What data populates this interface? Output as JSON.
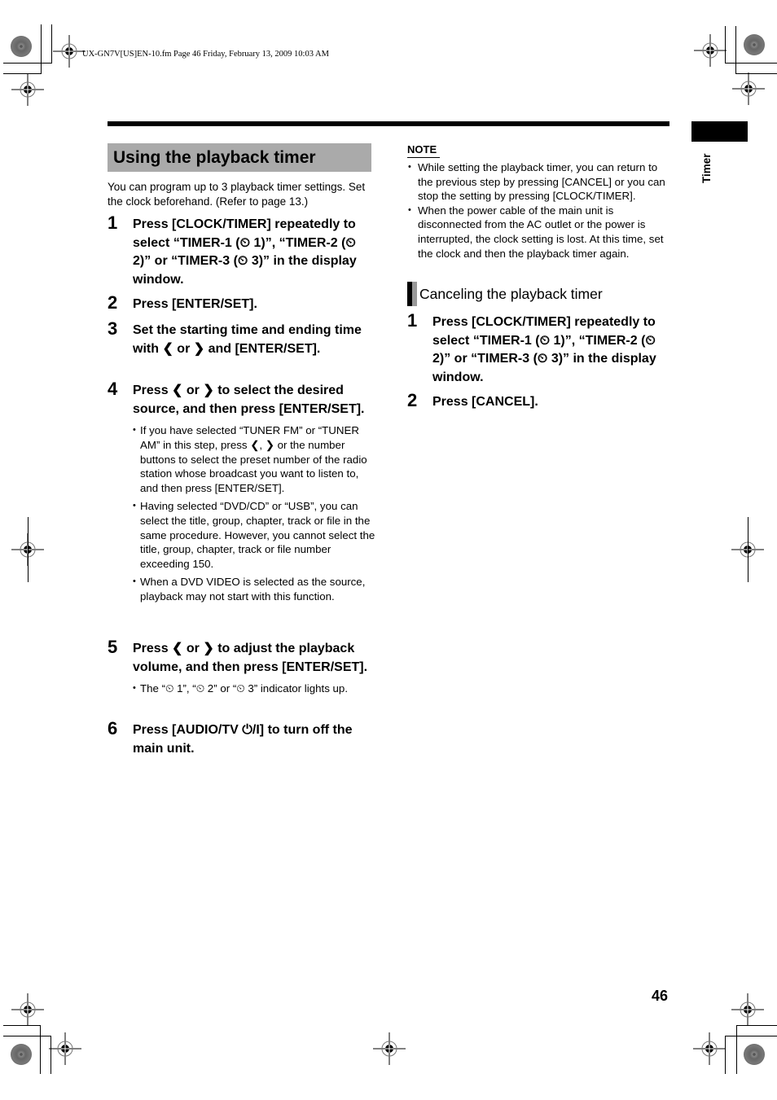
{
  "slug": "UX-GN7V[US]EN-10.fm  Page 46  Friday, February 13, 2009  10:03 AM",
  "side_tab": {
    "label": "Timer"
  },
  "section": {
    "title": "Using the playback timer",
    "intro": "You can program up to 3 playback timer settings. Set the clock beforehand. (Refer to page 13.)"
  },
  "steps": [
    {
      "num": "1",
      "text": "Press [CLOCK/TIMER] repeatedly to select “TIMER-1 (⏲ 1)”, “TIMER-2 (⏲ 2)” or “TIMER-3 (⏲ 3)” in the display window."
    },
    {
      "num": "2",
      "text": "Press [ENTER/SET]."
    },
    {
      "num": "3",
      "text": "Set the starting time and ending time with ❮ or ❯ and [ENTER/SET]."
    },
    {
      "num": "4",
      "text": "Press ❮ or ❯ to select the desired source, and then press [ENTER/SET].",
      "bullets": [
        "If you have selected “TUNER FM” or “TUNER AM” in this step, press ❮, ❯ or the number buttons to select the preset number of the radio station whose broadcast you want to listen to, and then press [ENTER/SET].",
        "Having selected “DVD/CD” or “USB”, you can select the title, group, chapter, track or file in the same procedure. However, you cannot select the title, group, chapter, track or file number exceeding 150.",
        "When a DVD VIDEO is selected as the source, playback may not start with this function."
      ]
    },
    {
      "num": "5",
      "text": "Press ❮ or ❯ to adjust the playback volume, and then press [ENTER/SET].",
      "bullets": [
        "The “⏲ 1”, “⏲ 2” or “⏲ 3” indicator lights up."
      ]
    },
    {
      "num": "6",
      "text": "Press [AUDIO/TV ⏻/I] to turn off the main unit."
    }
  ],
  "note": {
    "heading": "NOTE",
    "items": [
      "While setting the playback timer, you can return to the previous step by pressing [CANCEL] or you can stop the setting by pressing [CLOCK/TIMER].",
      "When the power cable of the main unit is disconnected from the AC outlet or the power is interrupted, the clock setting is lost. At this time, set the clock and then the playback timer again."
    ]
  },
  "cancel_section": {
    "title": "Canceling the playback timer",
    "steps": [
      {
        "num": "1",
        "text": "Press [CLOCK/TIMER] repeatedly to select “TIMER-1 (⏲ 1)”, “TIMER-2 (⏲ 2)” or “TIMER-3 (⏲ 3)” in the display window."
      },
      {
        "num": "2",
        "text": "Press [CANCEL]."
      }
    ]
  },
  "page_number": "46"
}
